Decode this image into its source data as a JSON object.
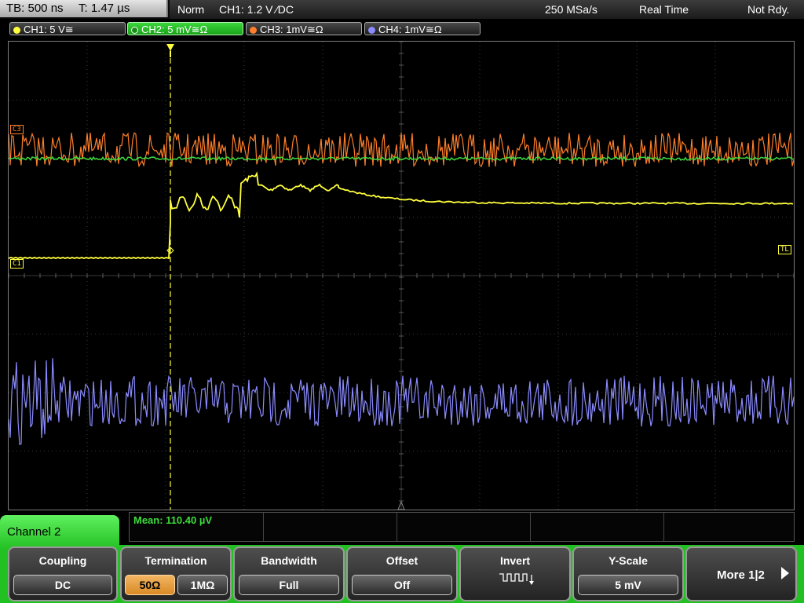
{
  "status": {
    "timebase": "TB: 500 ns",
    "trigger_time": "T: 1.47 µs",
    "mode": "Norm",
    "trigger_info": "CH1: 1.2 V ⁄DC",
    "sample_rate": "250 MSa/s",
    "acq_mode": "Real Time",
    "state": "Not Rdy."
  },
  "channels": [
    {
      "label": "CH1: 5 V≅",
      "color": "#ffff3d"
    },
    {
      "label": "CH2: 5 mV≅Ω",
      "color": "#3ddc3d",
      "active": true
    },
    {
      "label": "CH3: 1mV≅Ω",
      "color": "#ff7f2a"
    },
    {
      "label": "CH4: 1mV≅Ω",
      "color": "#8b8bff"
    }
  ],
  "markers": {
    "c3": "C3",
    "c1": "C1",
    "tl": "TL"
  },
  "measurement": {
    "text": "Mean: 110.40 µV"
  },
  "menu": {
    "title": "Channel 2",
    "softkeys": {
      "coupling": {
        "label": "Coupling",
        "value": "DC"
      },
      "termination": {
        "label": "Termination",
        "value_50": "50Ω",
        "value_1m": "1MΩ"
      },
      "bandwidth": {
        "label": "Bandwidth",
        "value": "Full"
      },
      "offset": {
        "label": "Offset",
        "value": "Off"
      },
      "invert": {
        "label": "Invert"
      },
      "yscale": {
        "label": "Y-Scale",
        "value": "5 mV"
      },
      "more": {
        "label": "More 1|2"
      }
    }
  },
  "colors": {
    "ch1": "#ffff3d",
    "ch2": "#3ddc3d",
    "ch3": "#ff7f2a",
    "ch4": "#8b8bff",
    "menu_green": "#22c022",
    "selected_orange": "#e09a3a"
  }
}
